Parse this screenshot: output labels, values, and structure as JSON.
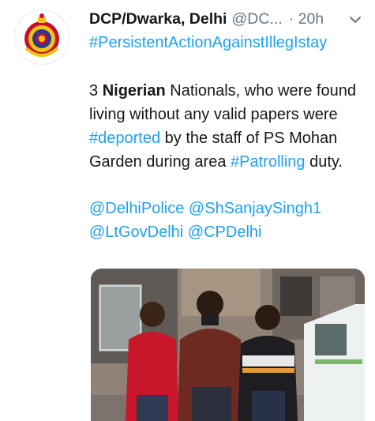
{
  "tweet": {
    "display_name": "DCP/Dwarka, Delhi",
    "handle": "@DC...",
    "time": "· 20h",
    "hashtag": "#PersistentActionAgainstIllegIstay",
    "body": {
      "prefix": "3 ",
      "bold_word": "Nigerian",
      "part1": " Nationals, who were found living without any valid papers were ",
      "hashtag_deported": "#deported",
      "part2": " by the staff of PS Mohan Garden during area ",
      "hashtag_patrolling": "#Patrolling",
      "part3": " duty."
    },
    "mentions": {
      "m1": "@DelhiPolice",
      "m2": "@ShSanjaySingh1",
      "m3": "@LtGovDelhi",
      "m4": "@CPDelhi"
    },
    "avatar_icon": "police-emblem-icon",
    "menu_icon": "chevron-down-icon",
    "colors": {
      "link": "#1da1f2",
      "muted": "#657786",
      "text": "#14171a"
    }
  }
}
